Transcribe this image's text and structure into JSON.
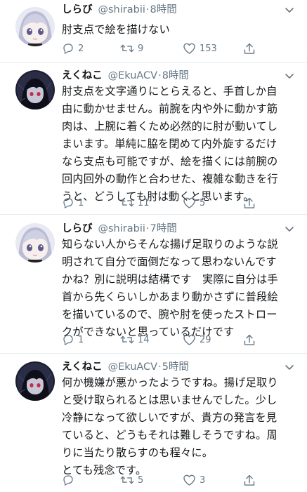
{
  "tweets": [
    {
      "name": "しらび",
      "handle": "@shirabii",
      "dot": "·",
      "time": "8時間",
      "lines": [
        "肘支点で絵を描けない"
      ],
      "replies": "2",
      "retweets": "9",
      "likes": "153",
      "avatar": "shirabi"
    },
    {
      "name": "えくねこ",
      "handle": "@EkuACV",
      "dot": "·",
      "time": "8時間",
      "lines": [
        "肘支点を文字通りにとらえると、手首しか自",
        "由に動かせません。前腕を内や外に動かす筋",
        "肉は、上腕に着くため必然的に肘が動いてし",
        "まいます。単純に脇を閉めて内外旋するだけ",
        "なら支点も可能ですが、絵を描くには前腕の",
        "回内回外の動作と合わせた、複雑な動きを行",
        "うと、どうしても肘は動くと思います。"
      ],
      "replies": "1",
      "retweets": "11",
      "likes": "5",
      "avatar": "ekuneko"
    },
    {
      "name": "しらび",
      "handle": "@shirabii",
      "dot": "·",
      "time": "7時間",
      "lines": [
        "知らない人からそんな揚げ足取りのような説",
        "明されて自分で面倒だなって思わないんです",
        "かね？別に説明は結構です　実際に自分は手",
        "首から先くらいしかあまり動かさずに普段絵",
        "を描いているので、腕や肘を使ったストロー",
        "クができないと思っているだけです"
      ],
      "replies": "1",
      "retweets": "14",
      "likes": "29",
      "avatar": "shirabi"
    },
    {
      "name": "えくねこ",
      "handle": "@EkuACV",
      "dot": "·",
      "time": "5時間",
      "lines": [
        "何か機嫌が悪かったようですね。揚げ足取り",
        "と受け取られるとは思いませんでした。少し",
        "冷静になって欲しいですが、貴方の発言を見",
        "ていると、どうもそれは難しそうですね。周",
        "りに当たり散らすのも程々に。",
        "とても残念です。"
      ],
      "replies": "",
      "retweets": "5",
      "likes": "3",
      "avatar": "ekuneko"
    }
  ],
  "icons": {
    "reply": "reply-icon",
    "retweet": "retweet-icon",
    "like": "heart-icon",
    "share": "share-icon",
    "caret": "chevron-down-icon"
  },
  "colors": {
    "text": "#14171a",
    "secondary": "#657786",
    "divider": "#e6ecf0",
    "background": "#ffffff"
  }
}
